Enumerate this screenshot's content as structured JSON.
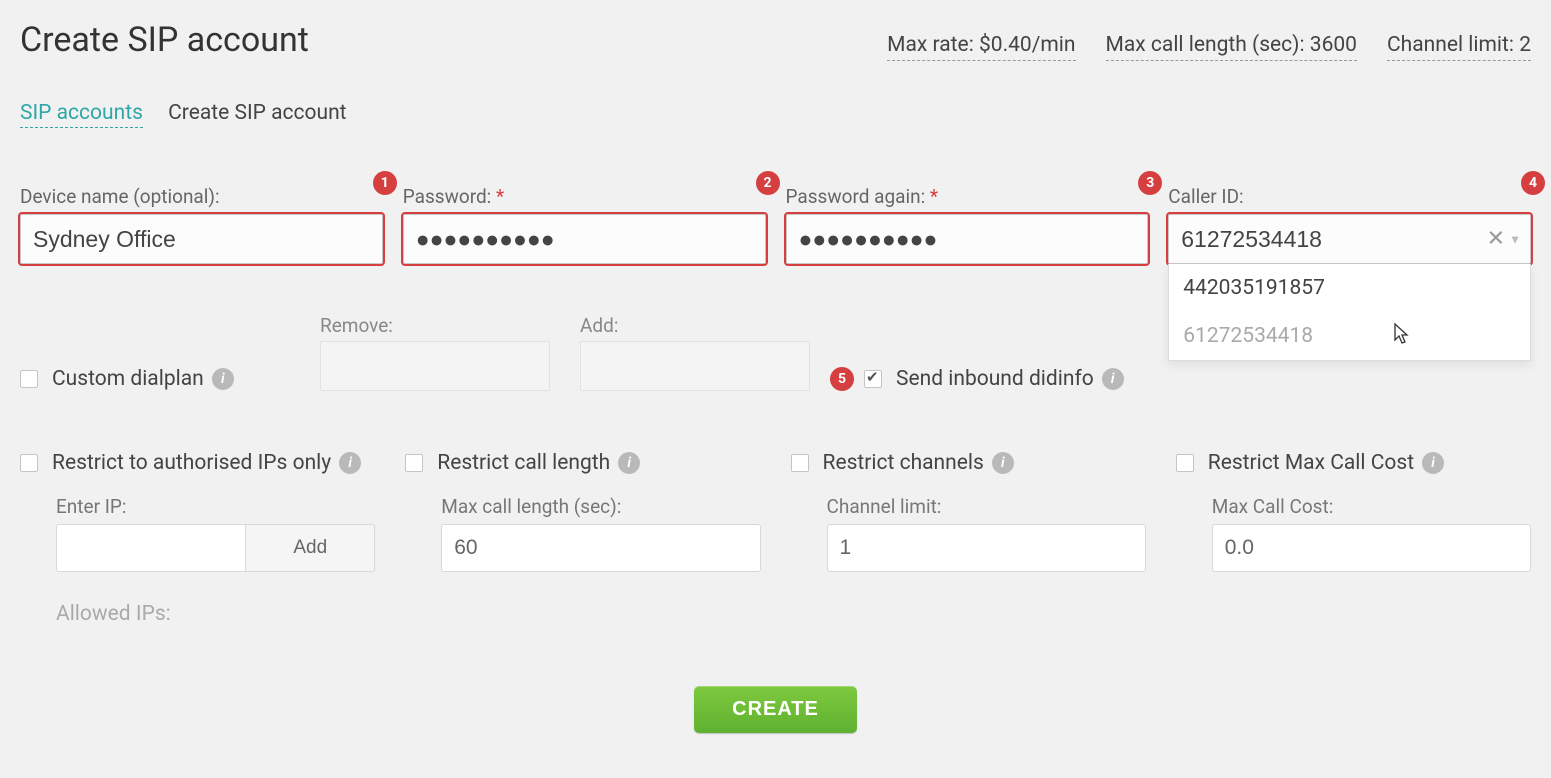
{
  "page_title": "Create SIP account",
  "stats": {
    "max_rate": "Max rate: $0.40/min",
    "max_call_len": "Max call length (sec): 3600",
    "channel_limit": "Channel limit: 2"
  },
  "breadcrumb": {
    "link": "SIP accounts",
    "current": "Create SIP account"
  },
  "fields": {
    "device": {
      "label": "Device name (optional):",
      "value": "Sydney Office",
      "badge": "1"
    },
    "password": {
      "label": "Password:",
      "display": "●●●●●●●●●●",
      "badge": "2"
    },
    "password2": {
      "label": "Password again:",
      "display": "●●●●●●●●●●",
      "badge": "3"
    },
    "callerid": {
      "label": "Caller ID:",
      "value": "61272534418",
      "badge": "4",
      "options": [
        "442035191857",
        "61272534418"
      ]
    }
  },
  "dialplan": {
    "custom_label": "Custom dialplan",
    "remove_label": "Remove:",
    "add_label": "Add:",
    "send_label": "Send inbound didinfo",
    "send_badge": "5"
  },
  "restrictions": {
    "ips": {
      "title": "Restrict to authorised IPs only",
      "sub": "Enter IP:",
      "add_btn": "Add",
      "allowed": "Allowed IPs:"
    },
    "length": {
      "title": "Restrict call length",
      "sub": "Max call length (sec):",
      "value": "60"
    },
    "channels": {
      "title": "Restrict channels",
      "sub": "Channel limit:",
      "value": "1"
    },
    "cost": {
      "title": "Restrict Max Call Cost",
      "sub": "Max Call Cost:",
      "value": "0.0"
    }
  },
  "create_btn": "CREATE"
}
